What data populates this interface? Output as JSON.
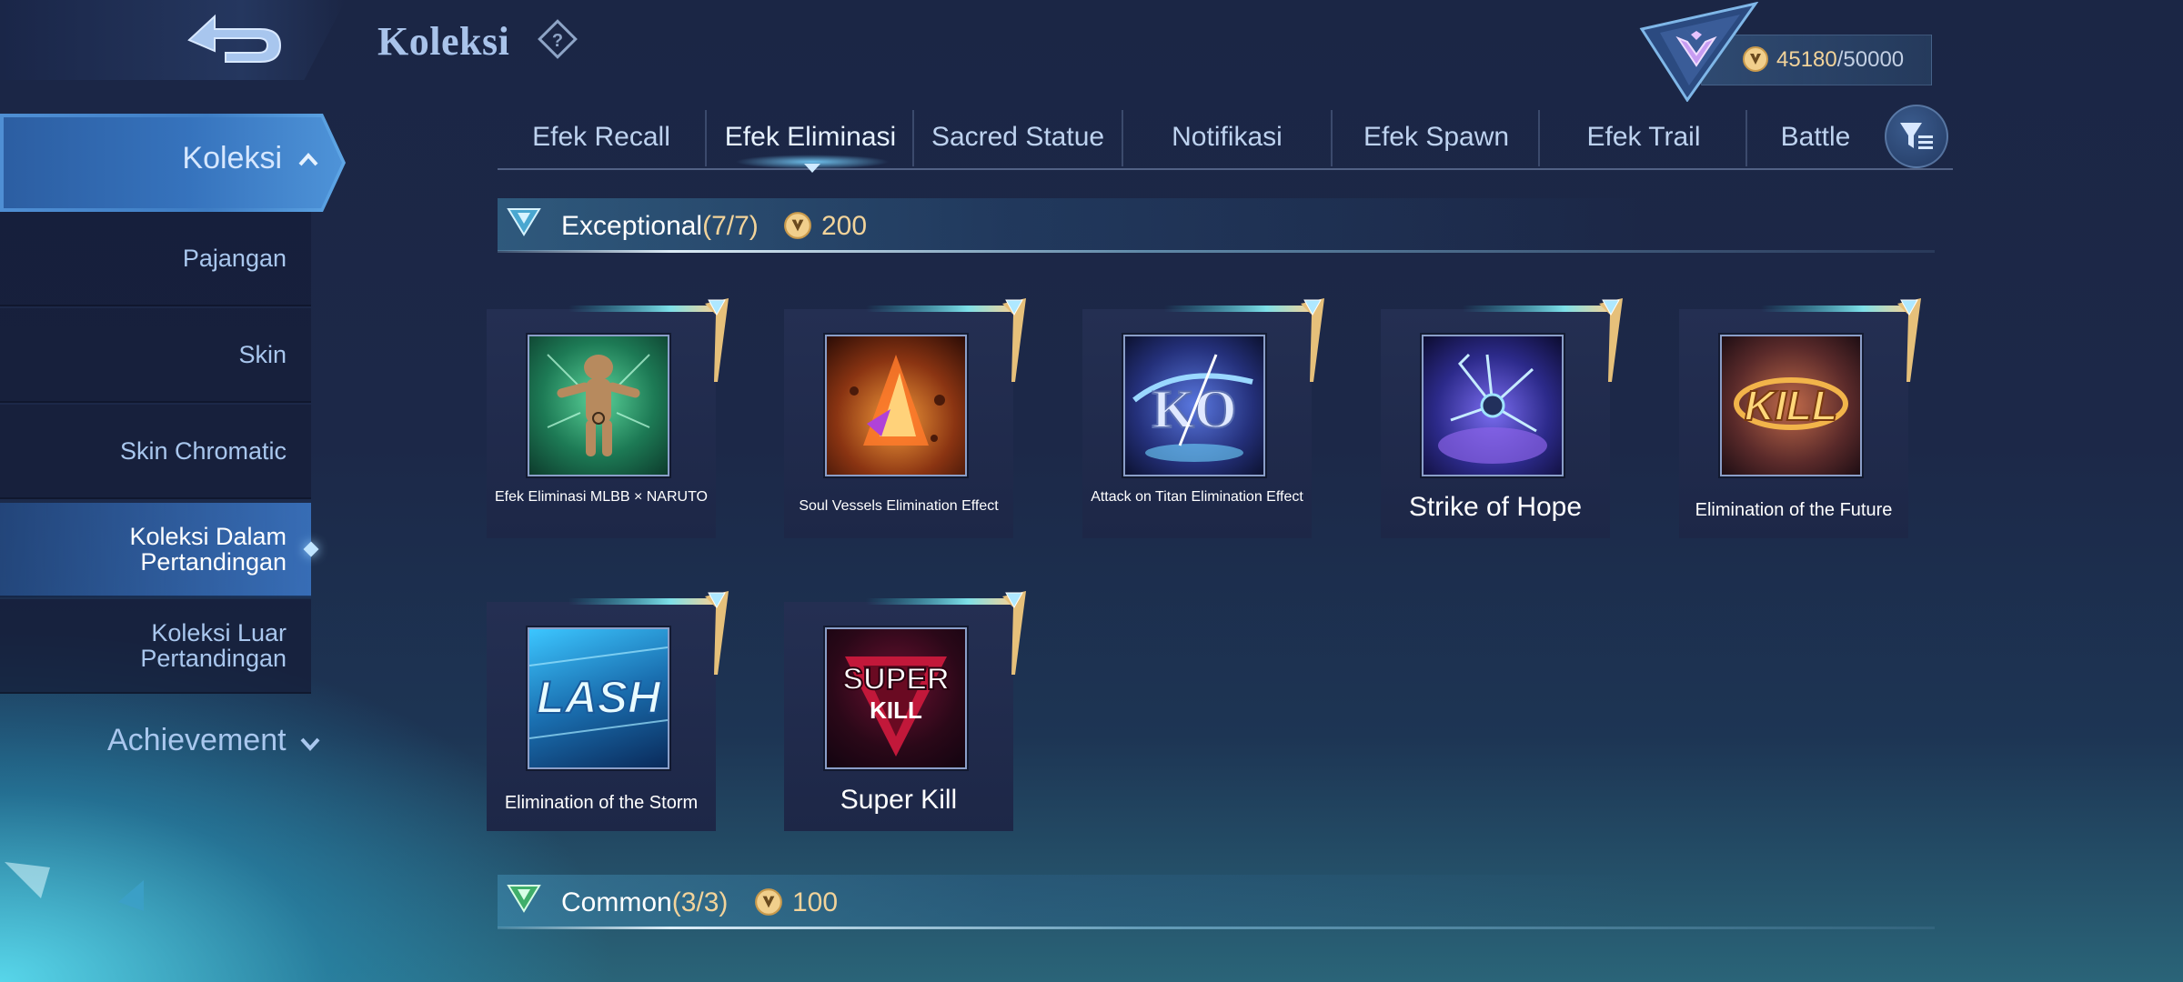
{
  "header": {
    "title": "Koleksi",
    "currency": {
      "current": "45180",
      "max": "/50000"
    }
  },
  "sidebar": {
    "active": "Koleksi",
    "items": [
      {
        "label": "Pajangan"
      },
      {
        "label": "Skin"
      },
      {
        "label": "Skin Chromatic"
      },
      {
        "label": "Koleksi Dalam Pertandingan",
        "selected": true
      },
      {
        "label": "Koleksi Luar Pertandingan"
      }
    ],
    "achievement": "Achievement"
  },
  "tabs": [
    {
      "label": "Efek Recall"
    },
    {
      "label": "Efek Eliminasi",
      "active": true
    },
    {
      "label": "Sacred Statue"
    },
    {
      "label": "Notifikasi"
    },
    {
      "label": "Efek Spawn"
    },
    {
      "label": "Efek Trail"
    },
    {
      "label": "Battle"
    }
  ],
  "sections": [
    {
      "title": "Exceptional",
      "count": "(7/7)",
      "price": "200",
      "items": [
        {
          "name": "Efek Eliminasi MLBB × NARUTO"
        },
        {
          "name": "Soul Vessels Elimination Effect"
        },
        {
          "name": "Attack on Titan Elimination Effect"
        },
        {
          "name": "Strike of Hope"
        },
        {
          "name": "Elimination of the Future"
        },
        {
          "name": "Elimination of the Storm"
        },
        {
          "name": "Super Kill"
        }
      ]
    },
    {
      "title": "Common",
      "count": "(3/3)",
      "price": "100"
    }
  ],
  "art_text": {
    "storm": "LASH",
    "super": "SUPER",
    "kill": "KILL",
    "future": "KILL",
    "titan": "KO"
  },
  "colors": {
    "accent_gold": "#f2d39a",
    "tab_text": "#bdd2ef",
    "sidebar_text": "#a9c7ee",
    "title": "#a9c3ea"
  },
  "icons": [
    "back-arrow-icon",
    "help-icon",
    "rank-badge-icon",
    "coin-icon",
    "chevron-up-icon",
    "chevron-down-icon",
    "filter-icon",
    "rarity-icon"
  ]
}
